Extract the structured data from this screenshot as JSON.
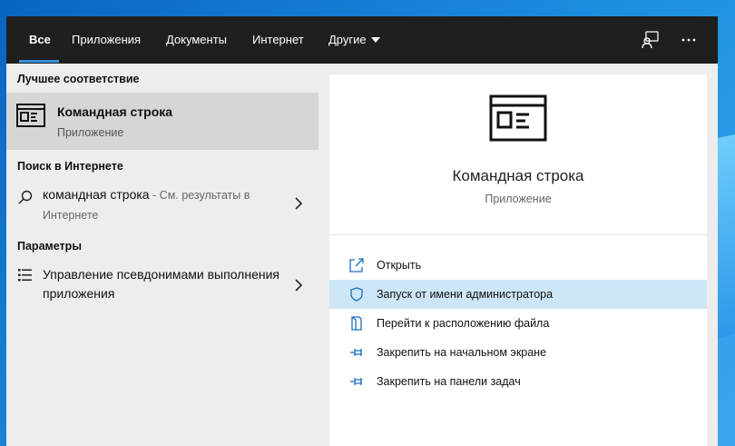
{
  "topbar": {
    "tabs": [
      {
        "label": "Все",
        "active": true
      },
      {
        "label": "Приложения"
      },
      {
        "label": "Документы"
      },
      {
        "label": "Интернет"
      },
      {
        "label": "Другие"
      }
    ],
    "icons": [
      "feedback-icon",
      "more-options-icon"
    ],
    "accent": "#3a8fde"
  },
  "left": {
    "best_match_heading": "Лучшее соответствие",
    "best_match": {
      "title": "Командная строка",
      "subtitle": "Приложение",
      "icon": "command-prompt-icon"
    },
    "web_heading": "Поиск в Интернете",
    "web_result": {
      "query": "командная строка",
      "hint": " - См. результаты в Интернете",
      "icon": "search-icon"
    },
    "settings_heading": "Параметры",
    "settings_result": {
      "label": "Управление псевдонимами выполнения приложения",
      "icon": "settings-list-icon"
    }
  },
  "preview": {
    "title": "Командная строка",
    "subtitle": "Приложение",
    "icon": "command-prompt-icon",
    "actions": [
      {
        "label": "Открыть",
        "icon": "open-icon"
      },
      {
        "label": "Запуск от имени администратора",
        "icon": "shield-icon",
        "highlighted": true
      },
      {
        "label": "Перейти к расположению файла",
        "icon": "file-location-icon"
      },
      {
        "label": "Закрепить на начальном экране",
        "icon": "pin-icon"
      },
      {
        "label": "Закрепить на панели задач",
        "icon": "pin-icon"
      }
    ],
    "highlight_color": "#cde6f7"
  }
}
